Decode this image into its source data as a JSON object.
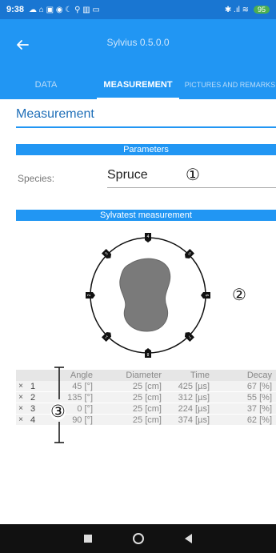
{
  "status_bar": {
    "time": "9:38",
    "icons": "☁ ⌂ ▣ ◉ ☾ ⚲ ▥ ▭",
    "signal": "✱ .ıl ≋",
    "battery": "95"
  },
  "app_bar": {
    "back_icon": "arrow-left-icon",
    "title": "Sylvius 0.5.0.0"
  },
  "tabs": [
    {
      "label": "DATA",
      "active": false
    },
    {
      "label": "MEASUREMENT",
      "active": true
    },
    {
      "label": "PICTURES AND REMARKS",
      "active": false
    }
  ],
  "measurement": {
    "title": "Measurement",
    "parameters_header": "Parameters",
    "species_label": "Species:",
    "species_value": "Spruce",
    "sylvatest_header": "Sylvatest measurement"
  },
  "annotations": {
    "one": "①",
    "two": "②",
    "three": "③"
  },
  "sensors": {
    "labels": [
      "4",
      "5",
      "6",
      "7",
      "8",
      "1",
      "2",
      "3"
    ]
  },
  "table": {
    "headers": {
      "angle": "Angle",
      "diameter": "Diameter",
      "time": "Time",
      "decay": "Decay"
    },
    "rows": [
      {
        "del": "×",
        "idx": "1",
        "angle": "45 [°]",
        "diameter": "25 [cm]",
        "time": "425 [µs]",
        "decay": "67 [%]"
      },
      {
        "del": "×",
        "idx": "2",
        "angle": "135 [°]",
        "diameter": "25 [cm]",
        "time": "312 [µs]",
        "decay": "55 [%]"
      },
      {
        "del": "×",
        "idx": "3",
        "angle": "0 [°]",
        "diameter": "25 [cm]",
        "time": "224 [µs]",
        "decay": "37 [%]"
      },
      {
        "del": "×",
        "idx": "4",
        "angle": "90 [°]",
        "diameter": "25 [cm]",
        "time": "374 [µs]",
        "decay": "62 [%]"
      }
    ]
  },
  "colors": {
    "primary": "#2196f3",
    "primary_dark": "#1976d2",
    "blob": "#7a7a7a"
  }
}
